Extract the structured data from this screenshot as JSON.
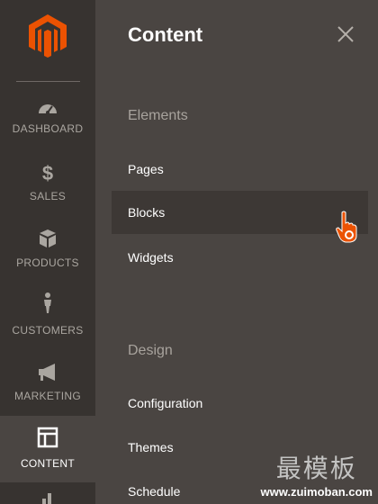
{
  "nav": {
    "items": [
      {
        "label": "DASHBOARD",
        "icon": "dashboard-gauge-icon"
      },
      {
        "label": "SALES",
        "icon": "dollar-icon"
      },
      {
        "label": "PRODUCTS",
        "icon": "box-icon"
      },
      {
        "label": "CUSTOMERS",
        "icon": "person-icon"
      },
      {
        "label": "MARKETING",
        "icon": "megaphone-icon"
      },
      {
        "label": "CONTENT",
        "icon": "layout-icon",
        "active": true
      }
    ]
  },
  "panel": {
    "title": "Content",
    "sections": [
      {
        "title": "Elements",
        "items": [
          "Pages",
          "Blocks",
          "Widgets"
        ]
      },
      {
        "title": "Design",
        "items": [
          "Configuration",
          "Themes",
          "Schedule"
        ]
      }
    ],
    "hovered_item": "Blocks"
  },
  "watermark": {
    "brand": "最模板",
    "url": "www.zuimoban.com"
  },
  "colors": {
    "accent": "#eb5202",
    "nav_bg": "#373330",
    "panel_bg": "#4a4542"
  }
}
